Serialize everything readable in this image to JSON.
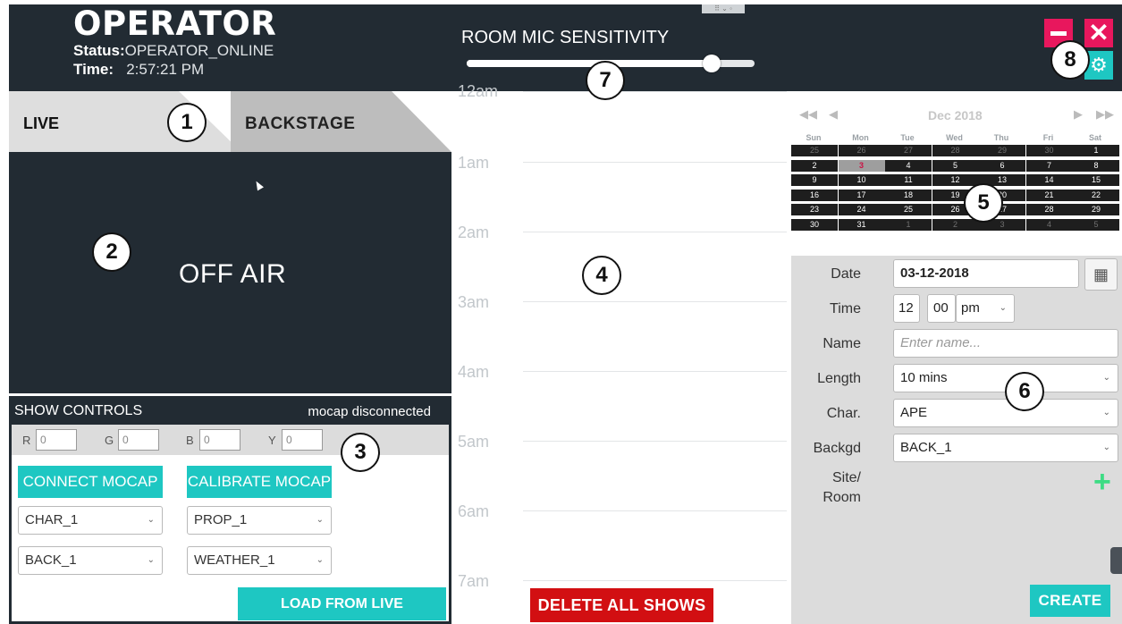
{
  "header": {
    "app_title": "OPERATOR",
    "status_label": "Status:",
    "status_value": "OPERATOR_ONLINE",
    "time_label": "Time:",
    "time_value": "2:57:21 PM",
    "mic_label": "ROOM MIC SENSITIVITY",
    "mic_level": 0.85
  },
  "tabs": [
    {
      "label": "LIVE",
      "active": true
    },
    {
      "label": "BACKSTAGE",
      "active": false
    }
  ],
  "live_view": {
    "status_text": "OFF AIR"
  },
  "show_controls": {
    "title": "SHOW CONTROLS",
    "mocap_status": "mocap disconnected",
    "rgb": [
      {
        "label": "R",
        "value": "0"
      },
      {
        "label": "G",
        "value": "0"
      },
      {
        "label": "B",
        "value": "0"
      },
      {
        "label": "Y",
        "value": "0"
      }
    ],
    "connect_label": "CONNECT MOCAP",
    "calibrate_label": "CALIBRATE MOCAP",
    "char_select": "CHAR_1",
    "prop_select": "PROP_1",
    "back_select": "BACK_1",
    "weather_select": "WEATHER_1",
    "load_label": "LOAD FROM LIVE"
  },
  "timeline": {
    "hours": [
      "12am",
      "1am",
      "2am",
      "3am",
      "4am",
      "5am",
      "6am",
      "7am"
    ],
    "delete_label": "DELETE ALL SHOWS"
  },
  "calendar": {
    "month_label": "Dec 2018",
    "weekdays": [
      "Sun",
      "Mon",
      "Tue",
      "Wed",
      "Thu",
      "Fri",
      "Sat"
    ],
    "weeks": [
      [
        "25",
        "26",
        "27",
        "28",
        "29",
        "30",
        "1"
      ],
      [
        "2",
        "3",
        "4",
        "5",
        "6",
        "7",
        "8"
      ],
      [
        "9",
        "10",
        "11",
        "12",
        "13",
        "14",
        "15"
      ],
      [
        "16",
        "17",
        "18",
        "19",
        "20",
        "21",
        "22"
      ],
      [
        "23",
        "24",
        "25",
        "26",
        "27",
        "28",
        "29"
      ],
      [
        "30",
        "31",
        "1",
        "2",
        "3",
        "4",
        "5"
      ]
    ],
    "selected_day": "3"
  },
  "form": {
    "date_label": "Date",
    "date_value": "03-12-2018",
    "time_label": "Time",
    "hour": "12",
    "minute": "00",
    "ampm": "pm",
    "name_label": "Name",
    "name_placeholder": "Enter name...",
    "length_label": "Length",
    "length_value": "10 mins",
    "char_label": "Char.",
    "char_value": "APE",
    "backgd_label": "Backgd",
    "backgd_value": "BACK_1",
    "site_label_1": "Site/",
    "site_label_2": "Room",
    "create_label": "CREATE"
  },
  "callouts": [
    "1",
    "2",
    "3",
    "4",
    "5",
    "6",
    "7",
    "8"
  ],
  "colors": {
    "dark_panel": "#222b33",
    "accent_teal": "#1ec7c2",
    "window_pink": "#e8175d",
    "delete_red": "#d20f12",
    "add_green": "#3ddc84"
  }
}
